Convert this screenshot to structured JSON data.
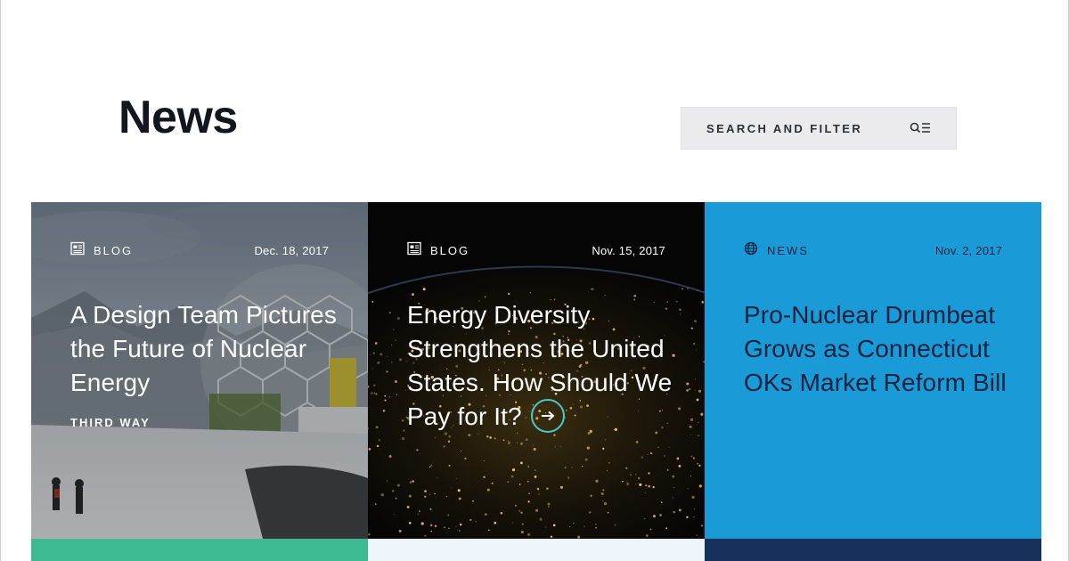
{
  "page": {
    "title": "News",
    "search": {
      "label": "SEARCH AND FILTER",
      "icon": "search-filter-icon"
    }
  },
  "colors": {
    "title": "#12171f",
    "search_bg": "#ebebed",
    "card3_bg": "#1a9ad6",
    "card1_strip": "#3dba92",
    "card2_strip": "#eef5fb",
    "card3_strip": "#15305a",
    "arrow_accent": "#4cc9c6"
  },
  "cards": [
    {
      "type": "BLOG",
      "type_icon": "newspaper-icon",
      "date": "Dec. 18, 2017",
      "headline": "A Design Team Pictures the Future of Nuclear Energy",
      "source": "THIRD WAY",
      "image": "snowy landscape with geodesic dome"
    },
    {
      "type": "BLOG",
      "type_icon": "newspaper-icon",
      "date": "Nov. 15, 2017",
      "headline": "Energy Diversity Strengthens the United States. How Should We Pay for It?",
      "arrow_icon": "arrow-right-icon",
      "image": "night-time earth city lights"
    },
    {
      "type": "NEWS",
      "type_icon": "globe-icon",
      "date": "Nov. 2, 2017",
      "headline": "Pro-Nuclear Drumbeat Grows as Connecticut OKs Market Reform Bill"
    }
  ]
}
